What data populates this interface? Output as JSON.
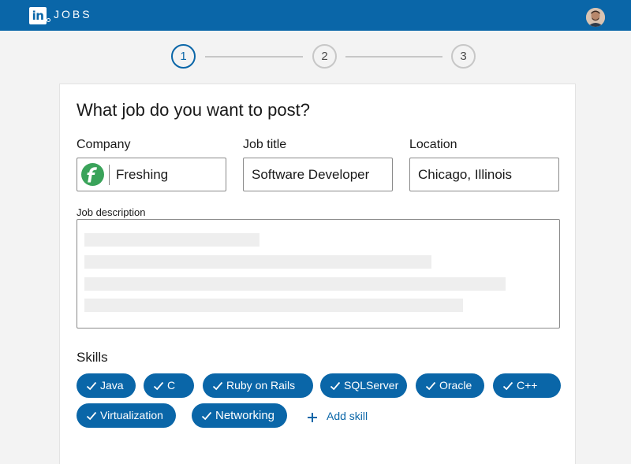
{
  "header": {
    "brand": "JOBS",
    "logo_text": "in"
  },
  "stepper": {
    "steps": [
      "1",
      "2",
      "3"
    ],
    "active": 0
  },
  "form": {
    "title": "What job do you want to post?",
    "company": {
      "label": "Company",
      "value": "Freshing"
    },
    "job_title": {
      "label": "Job title",
      "value": "Software Developer"
    },
    "location": {
      "label": "Location",
      "value": "Chicago, Illinois"
    },
    "description": {
      "label": "Job description"
    },
    "skills": {
      "label": "Skills",
      "items": [
        "Java",
        "C",
        "Ruby on Rails",
        "SQLServer",
        "Oracle",
        "C++",
        "Virtualization",
        "Networking"
      ],
      "add_label": "Add skill"
    }
  },
  "colors": {
    "brand": "#0a66a8",
    "company_logo": "#3aa35a"
  },
  "icons": {
    "logo": "linkedin-logo-icon",
    "check": "check-icon",
    "add": "plus-icon",
    "company": "freshing-logo-icon"
  }
}
